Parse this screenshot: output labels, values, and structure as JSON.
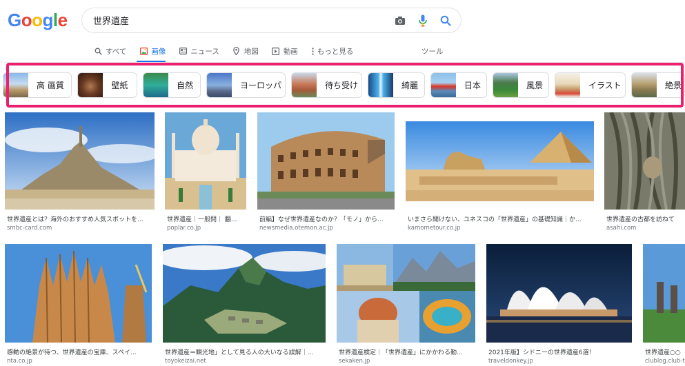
{
  "logo": "Google",
  "search": {
    "query": "世界遺産"
  },
  "tabs": [
    {
      "label": "すべて",
      "icon": "search-icon"
    },
    {
      "label": "画像",
      "icon": "image-icon",
      "active": true
    },
    {
      "label": "ニュース",
      "icon": "news-icon"
    },
    {
      "label": "地図",
      "icon": "map-pin-icon"
    },
    {
      "label": "動画",
      "icon": "video-icon"
    },
    {
      "label": "もっと見る",
      "icon": "more-vert-icon"
    }
  ],
  "tools_label": "ツール",
  "chips": [
    {
      "label": "高 画質"
    },
    {
      "label": "壁紙"
    },
    {
      "label": "自然"
    },
    {
      "label": "ヨーロッパ"
    },
    {
      "label": "待ち受け"
    },
    {
      "label": "綺麗"
    },
    {
      "label": "日本"
    },
    {
      "label": "風景"
    },
    {
      "label": "イラスト"
    },
    {
      "label": "絶景"
    }
  ],
  "results": [
    {
      "caption": "世界遺産とは？海外のおすすめ人気スポットを...",
      "source": "smbc-card.com"
    },
    {
      "caption": "世界遺産｜一般問｜ 翻...",
      "source": "poplar.co.jp"
    },
    {
      "caption": "前編】なぜ世界遺産なのか？「モノ」から...",
      "source": "newsmedia.otemon.ac.jp"
    },
    {
      "caption": "いまさら聞けない、ユネスコの「世界遺産」の基礎知識｜か...",
      "source": "kamometour.co.jp"
    },
    {
      "caption": "世界遺産の古都を訪ねて",
      "source": "asahi.com"
    },
    {
      "caption": "感動の絶景が待つ、世界遺産の宝庫、スペイ...",
      "source": "nta.co.jp"
    },
    {
      "caption": "世界遺産＝観光地」として見る人の大いなる誤解｜...",
      "source": "toyokeizai.net"
    },
    {
      "caption": "世界遺産検定｜「世界遺産」にかかわる勤...",
      "source": "sekaken.jp"
    },
    {
      "caption": "2021年版】シドニーの世界遺産6選！",
      "source": "traveldonkey.jp"
    },
    {
      "caption": "世界遺産○○",
      "source": "clublog.club-t"
    }
  ]
}
